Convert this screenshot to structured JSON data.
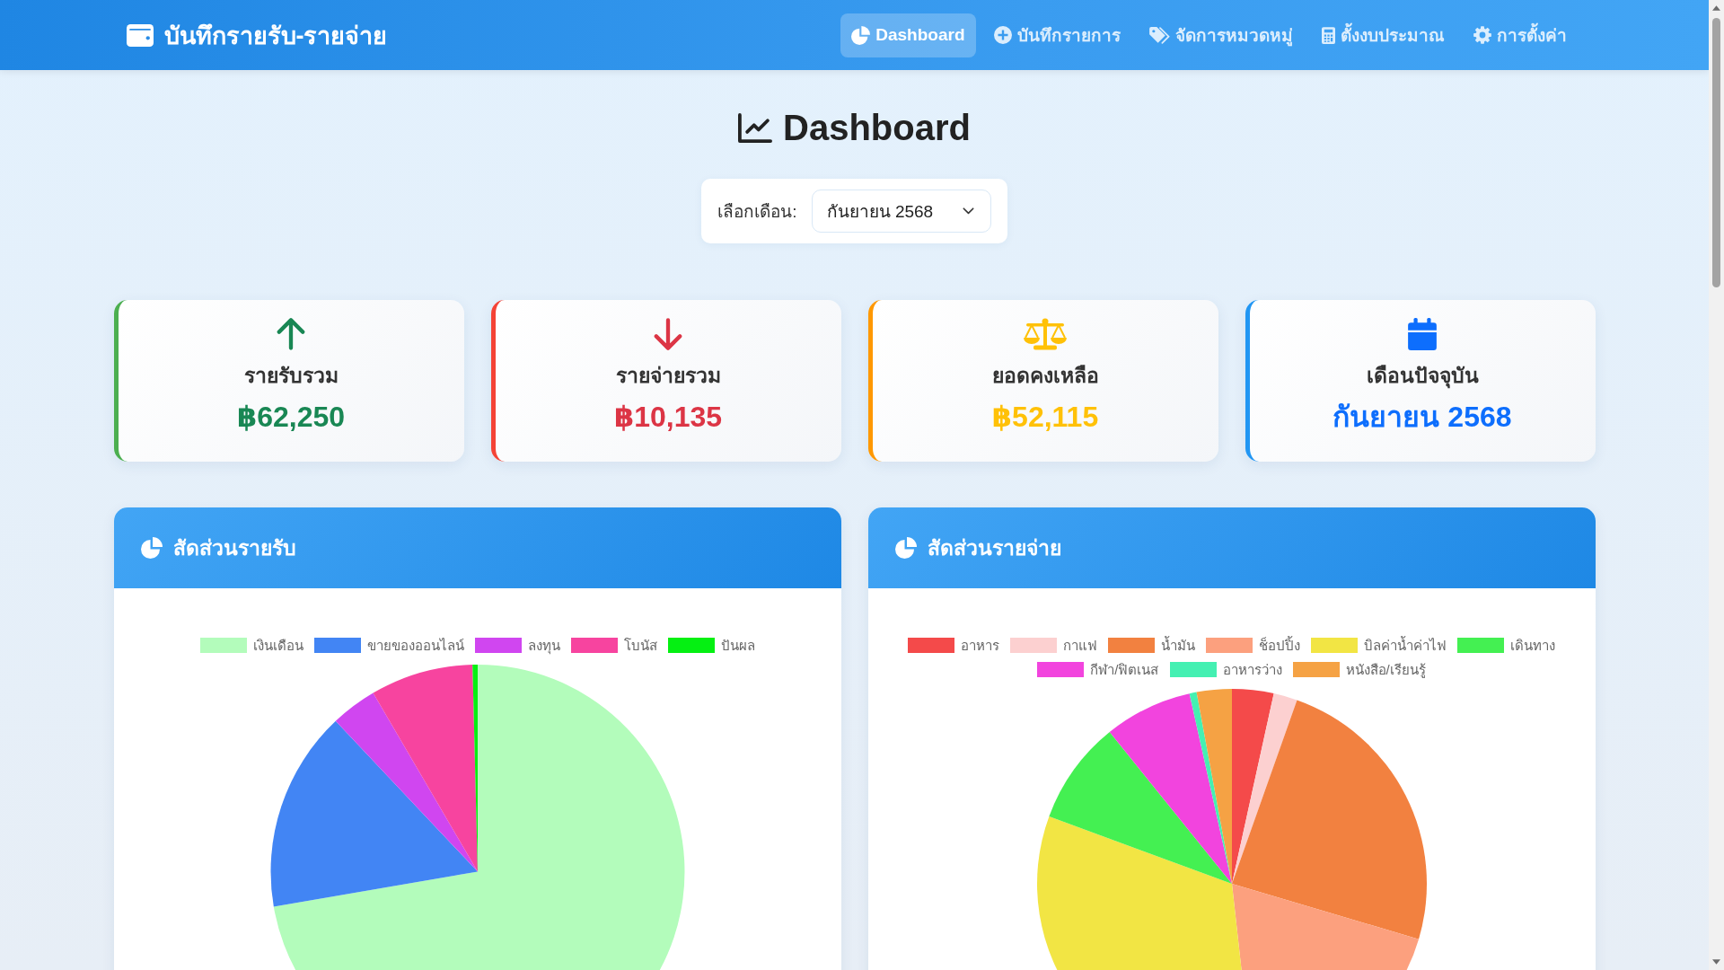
{
  "navbar": {
    "brand": "บันทึกรายรับ-รายจ่าย",
    "items": [
      {
        "label": "Dashboard",
        "selected": true
      },
      {
        "label": "บันทึกรายการ",
        "selected": false
      },
      {
        "label": "จัดการหมวดหมู่",
        "selected": false
      },
      {
        "label": "ตั้งงบประมาณ",
        "selected": false
      },
      {
        "label": "การตั้งค่า",
        "selected": false
      }
    ]
  },
  "page_title": "Dashboard",
  "month_filter": {
    "label": "เลือกเดือน:",
    "value": "กันยายน 2568"
  },
  "summary_cards": [
    {
      "kind": "income",
      "title": "รายรับรวม",
      "value": "฿62,250"
    },
    {
      "kind": "expense",
      "title": "รายจ่ายรวม",
      "value": "฿10,135"
    },
    {
      "kind": "balance",
      "title": "ยอดคงเหลือ",
      "value": "฿52,115"
    },
    {
      "kind": "month",
      "title": "เดือนปัจจุบัน",
      "value": "กันยายน 2568"
    }
  ],
  "charts": [
    {
      "title": "สัดส่วนรายรับ",
      "chart_data": {
        "type": "pie",
        "legend": "top",
        "categories": [
          "เงินเดือน",
          "ขายของออนไลน์",
          "ลงทุน",
          "โบนัส",
          "ปันผล"
        ],
        "values": [
          72.3,
          15.66,
          3.61,
          8.03,
          0.4
        ],
        "colors": [
          "#b3fcbb",
          "#4285f4",
          "#d046f0",
          "#f7449f",
          "#05f012"
        ]
      }
    },
    {
      "title": "สัดส่วนรายจ่าย",
      "chart_data": {
        "type": "pie",
        "legend": "top",
        "categories": [
          "อาหาร",
          "กาแฟ",
          "น้ำมัน",
          "ช็อปปิ้ง",
          "บิลค่าน้ำค่าไฟ",
          "เดินทาง",
          "กีฬา/ฟิตเนส",
          "อาหารว่าง",
          "หนังสือ/เรียนรู้"
        ],
        "values": [
          3.45,
          1.97,
          24.17,
          18.65,
          32.38,
          8.58,
          7.3,
          0.59,
          2.91
        ],
        "colors": [
          "#f44a4a",
          "#fcd0d0",
          "#f28140",
          "#fca07e",
          "#f2e544",
          "#44f052",
          "#f244de",
          "#44f0b2",
          "#f5a244"
        ]
      }
    }
  ]
}
